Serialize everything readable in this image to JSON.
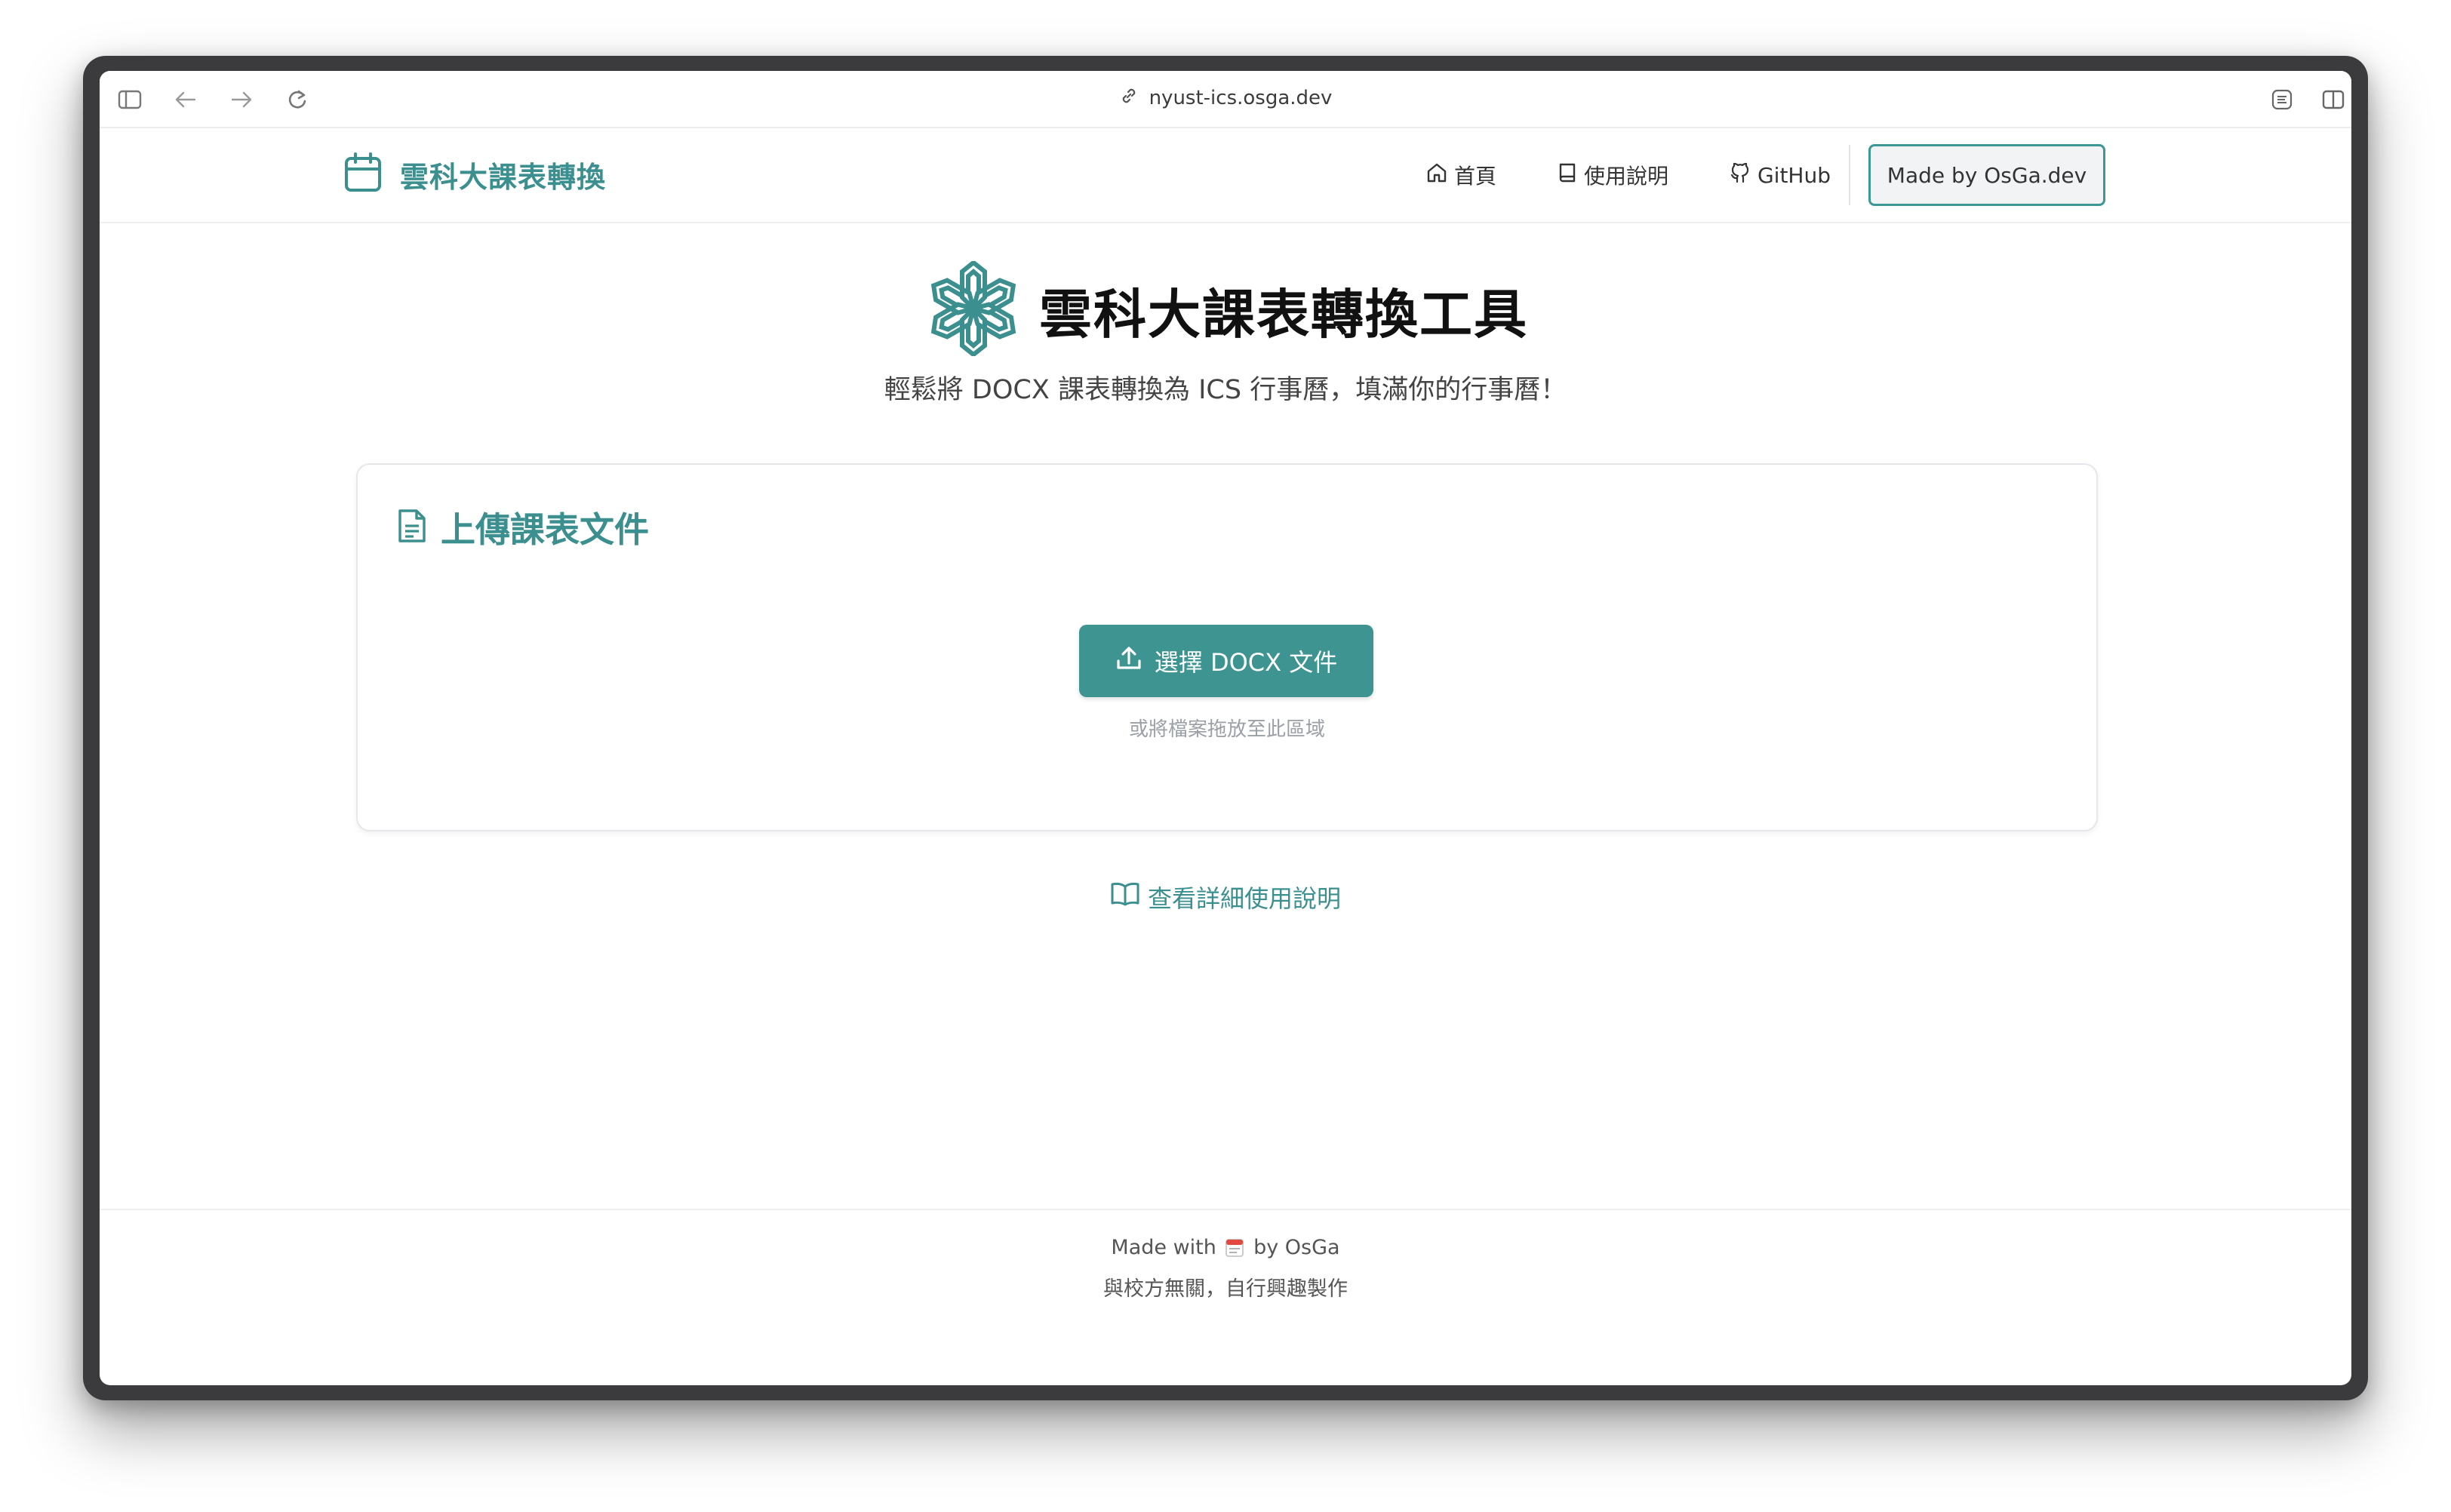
{
  "browser": {
    "url": "nyust-ics.osga.dev"
  },
  "header": {
    "brand": "雲科大課表轉換",
    "nav": [
      {
        "label": "首頁",
        "icon": "home-icon"
      },
      {
        "label": "使用說明",
        "icon": "book-icon"
      },
      {
        "label": "GitHub",
        "icon": "github-icon"
      }
    ],
    "made_by_button": "Made by OsGa.dev"
  },
  "hero": {
    "title": "雲科大課表轉換工具",
    "subtitle": "輕鬆將 DOCX 課表轉換為 ICS 行事曆，填滿你的行事曆！"
  },
  "upload_card": {
    "title": "上傳課表文件",
    "button_label": "選擇 DOCX 文件",
    "drop_hint": "或將檔案拖放至此區域"
  },
  "guide_link": "查看詳細使用說明",
  "footer": {
    "made_with_prefix": "Made with",
    "made_with_suffix": "by OsGa",
    "disclaimer": "與校方無關，自行興趣製作"
  },
  "colors": {
    "accent": "#3e9491",
    "brand_text": "#3b8f8e"
  }
}
